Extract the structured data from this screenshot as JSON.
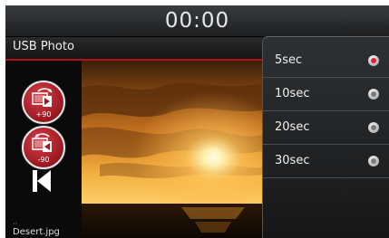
{
  "status": {
    "clock": "00:00"
  },
  "header": {
    "title": "USB Photo"
  },
  "controls": {
    "rotate_right_label": "+90",
    "rotate_left_label": "-90"
  },
  "file": {
    "name": "Desert.jpg",
    "marker": "··"
  },
  "slideshow_menu": {
    "options": [
      {
        "label": "5sec",
        "selected": true
      },
      {
        "label": "10sec",
        "selected": false
      },
      {
        "label": "20sec",
        "selected": false
      },
      {
        "label": "30sec",
        "selected": false
      }
    ]
  },
  "colors": {
    "accent_red": "#b0121a",
    "selected_radio": "#e0232d"
  }
}
